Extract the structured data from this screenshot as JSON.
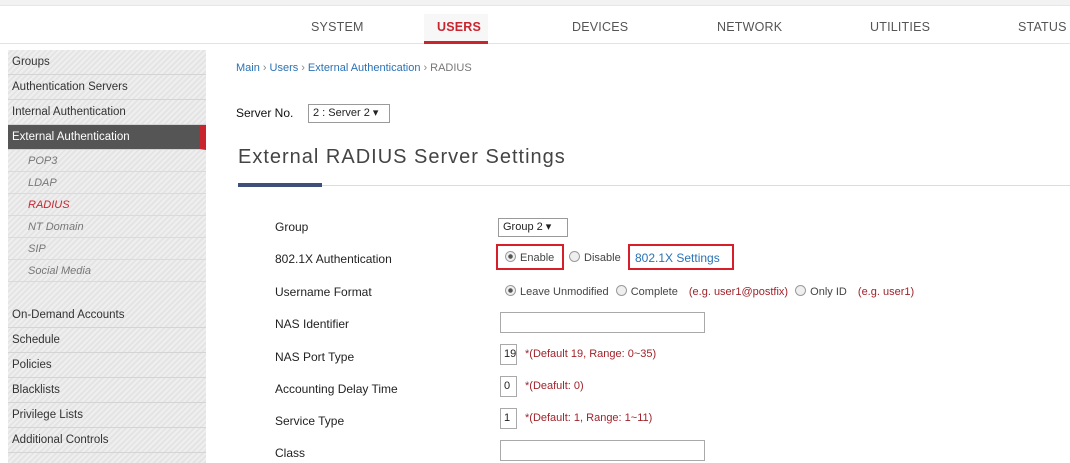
{
  "nav": {
    "tabs": [
      {
        "label": "SYSTEM",
        "active": false
      },
      {
        "label": "USERS",
        "active": true
      },
      {
        "label": "DEVICES",
        "active": false
      },
      {
        "label": "NETWORK",
        "active": false
      },
      {
        "label": "UTILITIES",
        "active": false
      },
      {
        "label": "STATUS",
        "active": false
      }
    ]
  },
  "sidebar": {
    "items": [
      {
        "label": "Groups"
      },
      {
        "label": "Authentication Servers"
      },
      {
        "label": "Internal Authentication"
      },
      {
        "label": "External Authentication",
        "active": true
      },
      {
        "label": "POP3",
        "sub": true
      },
      {
        "label": "LDAP",
        "sub": true
      },
      {
        "label": "RADIUS",
        "sub": true,
        "active": true
      },
      {
        "label": "NT Domain",
        "sub": true
      },
      {
        "label": "SIP",
        "sub": true
      },
      {
        "label": "Social Media",
        "sub": true
      },
      {
        "label": "On-Demand Accounts"
      },
      {
        "label": "Schedule"
      },
      {
        "label": "Policies"
      },
      {
        "label": "Blacklists"
      },
      {
        "label": "Privilege Lists"
      },
      {
        "label": "Additional Controls"
      }
    ]
  },
  "breadcrumb": [
    "Main",
    "Users",
    "External Authentication",
    "RADIUS"
  ],
  "server": {
    "label": "Server No.",
    "value": "2 : Server 2 ▾"
  },
  "page_title": "External RADIUS Server Settings",
  "form": {
    "group": {
      "label": "Group",
      "value": "Group 2 ▾"
    },
    "dot1x": {
      "label": "802.1X Authentication",
      "enable": "Enable",
      "disable": "Disable",
      "settings_link": "802.1X Settings",
      "selected": "Enable"
    },
    "username_format": {
      "label": "Username Format",
      "opt1": "Leave Unmodified",
      "opt2": "Complete",
      "opt2_hint": "(e.g. user1@postfix)",
      "opt3": "Only ID",
      "opt3_hint": "(e.g. user1)",
      "selected": "Leave Unmodified"
    },
    "nas_identifier": {
      "label": "NAS Identifier",
      "value": ""
    },
    "nas_port_type": {
      "label": "NAS Port Type",
      "value": "19",
      "note": "*(Default 19, Range: 0~35)"
    },
    "accounting_delay": {
      "label": "Accounting Delay Time",
      "value": "0",
      "note": "*(Deafult: 0)"
    },
    "service_type": {
      "label": "Service Type",
      "value": "1",
      "note": "*(Default: 1, Range: 1~11)"
    },
    "class": {
      "label": "Class",
      "value": ""
    }
  }
}
